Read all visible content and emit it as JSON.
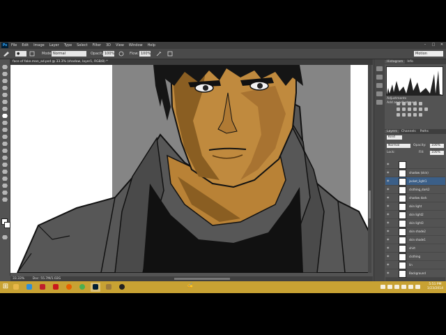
{
  "app": {
    "logo": "Ps",
    "menus": [
      "File",
      "Edit",
      "Image",
      "Layer",
      "Type",
      "Select",
      "Filter",
      "3D",
      "View",
      "Window",
      "Help"
    ],
    "window_controls": [
      "–",
      "□",
      "✕"
    ]
  },
  "options_bar": {
    "mode_label": "Mode:",
    "mode_value": "Normal",
    "opacity_label": "Opacity:",
    "opacity_value": "100%",
    "flow_label": "Flow:",
    "flow_value": "100%",
    "workspace": "Motion"
  },
  "document": {
    "tab_title": "face of fake.man_ad.psd @ 33.3% (shadow, layer1, RGB/8) *",
    "zoom": "33.33%",
    "doc_info": "Doc: 55.7M/1.02G"
  },
  "panels": {
    "top_tabs": [
      "Histogram",
      "Info"
    ],
    "adjustments_title": "Adjustments",
    "adjustments_hint": "Add an adjustment",
    "layer_tabs": [
      "Layers",
      "Channels",
      "Paths"
    ],
    "kind_label": "Kind",
    "blend_mode": "Normal",
    "opacity_label": "Opacity:",
    "opacity_value": "100%",
    "lock_label": "Lock:",
    "fill_label": "Fill:",
    "fill_value": "100%",
    "layers": [
      {
        "name": "",
        "selected": false
      },
      {
        "name": "shadow (skin)",
        "selected": false
      },
      {
        "name": "jacket_light1",
        "selected": true
      },
      {
        "name": "clothing_dark2",
        "selected": false
      },
      {
        "name": "shadow dark",
        "selected": false
      },
      {
        "name": "skin light",
        "selected": false
      },
      {
        "name": "skin light2",
        "selected": false
      },
      {
        "name": "skin light3",
        "selected": false
      },
      {
        "name": "skin shade2",
        "selected": false
      },
      {
        "name": "skin shade1",
        "selected": false
      },
      {
        "name": "shirt",
        "selected": false
      },
      {
        "name": "clothing",
        "selected": false
      },
      {
        "name": "lin",
        "selected": false
      },
      {
        "name": "Background",
        "selected": false
      }
    ]
  },
  "taskbar": {
    "apps": [
      "explorer",
      "ie",
      "filezilla",
      "acrobat",
      "firefox",
      "chrome",
      "photoshop",
      "photos",
      "obs"
    ],
    "active_app": "photoshop",
    "signature": "CeeFee",
    "time": "5:51 PM",
    "date": "1/23/2014"
  },
  "colors": {
    "skin": "#c08a3e",
    "skin_shadow": "#8a5e22",
    "jacket": "#555555",
    "taskbar": "#c8a233",
    "selection": "#3b5f88"
  }
}
